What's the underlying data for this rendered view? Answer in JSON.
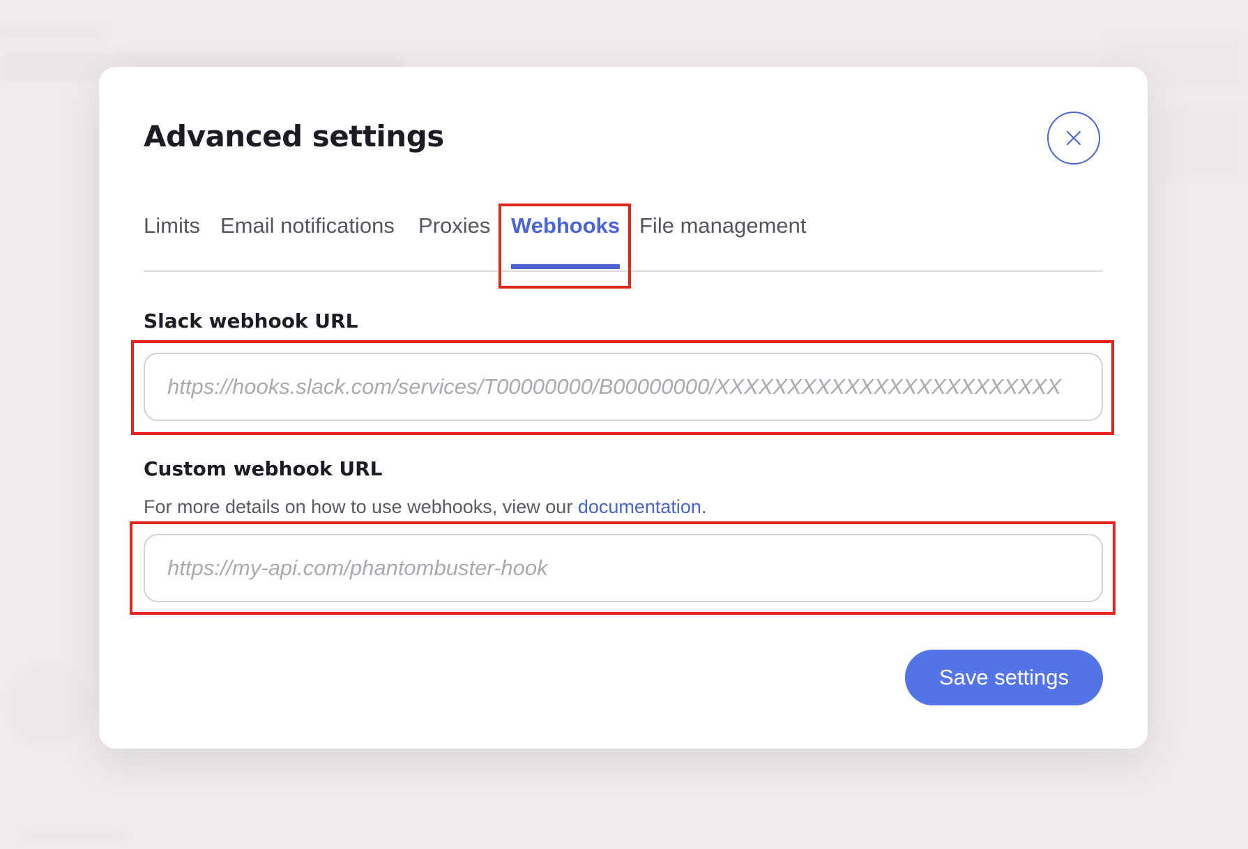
{
  "modal": {
    "title": "Advanced settings",
    "close_icon": "close-icon"
  },
  "tabs": [
    {
      "label": "Limits",
      "active": false
    },
    {
      "label": "Email notifications",
      "active": false
    },
    {
      "label": "Proxies",
      "active": false
    },
    {
      "label": "Webhooks",
      "active": true
    },
    {
      "label": "File management",
      "active": false
    }
  ],
  "slack": {
    "label": "Slack webhook URL",
    "value": "",
    "placeholder": "https://hooks.slack.com/services/T00000000/B00000000/XXXXXXXXXXXXXXXXXXXXXXXX"
  },
  "custom": {
    "label": "Custom webhook URL",
    "help_prefix": "For more details on how to use webhooks, view our ",
    "help_link": "documentation",
    "help_suffix": ".",
    "value": "",
    "placeholder": "https://my-api.com/phantombuster-hook"
  },
  "actions": {
    "save_label": "Save settings"
  },
  "colors": {
    "accent": "#4a64d6",
    "button": "#5474e6",
    "annotation": "#e0281c"
  }
}
